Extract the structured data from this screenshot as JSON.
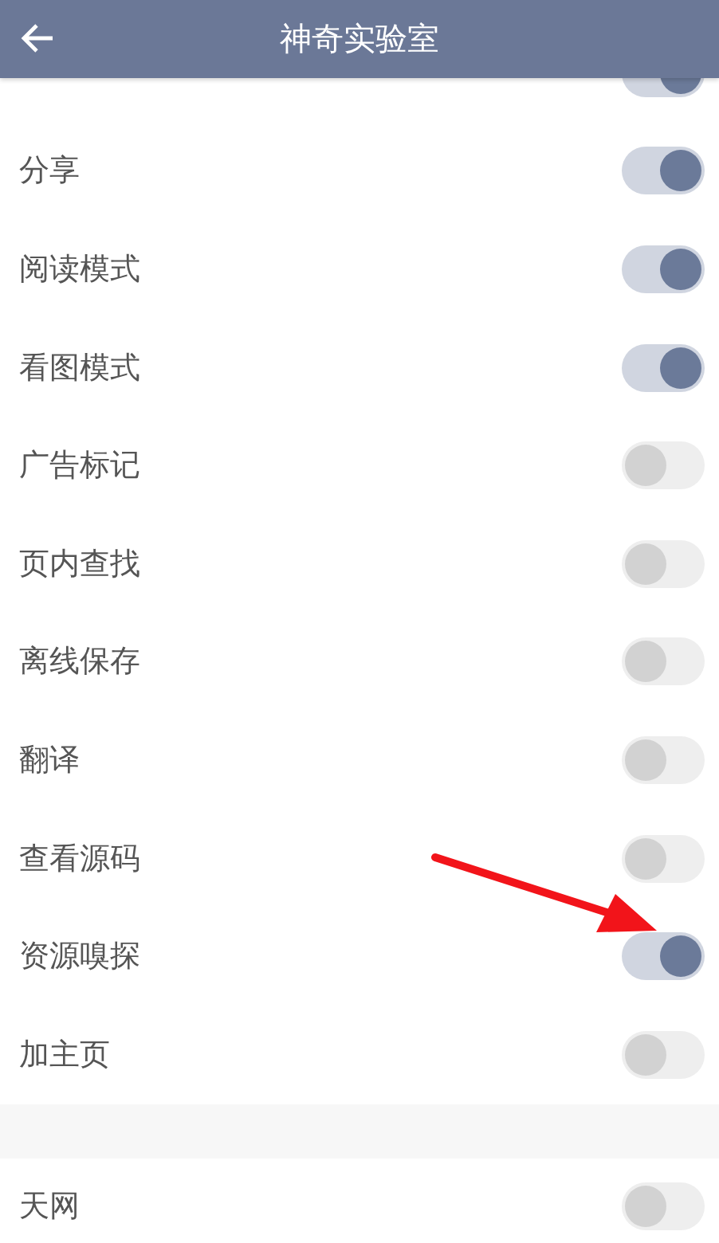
{
  "header": {
    "title": "神奇实验室"
  },
  "top_partial_switch": {
    "on": true
  },
  "settings": [
    {
      "label": "分享",
      "on": true
    },
    {
      "label": "阅读模式",
      "on": true
    },
    {
      "label": "看图模式",
      "on": true
    },
    {
      "label": "广告标记",
      "on": false
    },
    {
      "label": "页内查找",
      "on": false
    },
    {
      "label": "离线保存",
      "on": false
    },
    {
      "label": "翻译",
      "on": false
    },
    {
      "label": "查看源码",
      "on": false
    },
    {
      "label": "资源嗅探",
      "on": true
    },
    {
      "label": "加主页",
      "on": false
    }
  ],
  "more_settings": [
    {
      "label": "天网",
      "on": false
    }
  ]
}
